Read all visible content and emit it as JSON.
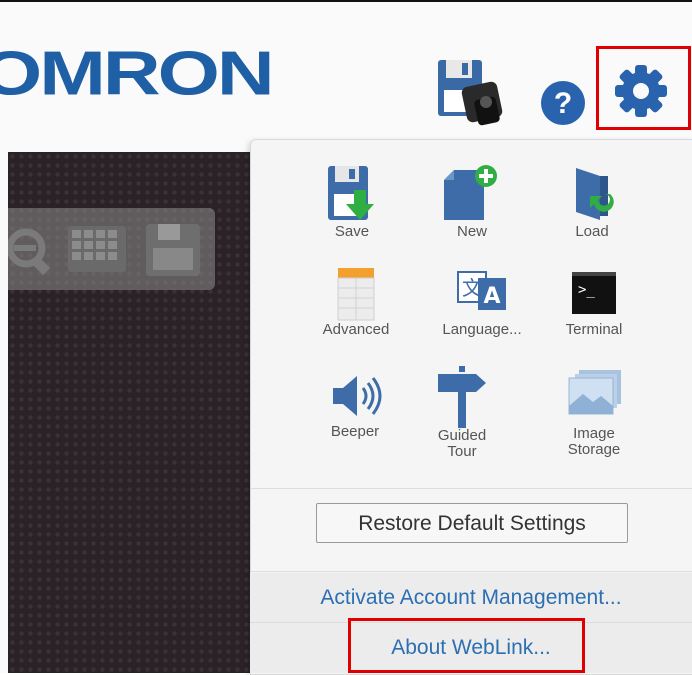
{
  "header": {
    "logo_text": "OMRON"
  },
  "menu": {
    "items": [
      {
        "label": "Save",
        "icon": "save-icon"
      },
      {
        "label": "New",
        "icon": "new-file-icon"
      },
      {
        "label": "Load",
        "icon": "load-icon"
      },
      {
        "label": "Advanced",
        "icon": "advanced-table-icon"
      },
      {
        "label": "Language...",
        "icon": "language-icon"
      },
      {
        "label": "Terminal",
        "icon": "terminal-icon"
      },
      {
        "label": "Beeper",
        "icon": "speaker-icon"
      },
      {
        "label_line1": "Guided",
        "label_line2": "Tour",
        "icon": "signpost-icon"
      },
      {
        "label_line1": "Image",
        "label_line2": "Storage",
        "icon": "image-storage-icon"
      }
    ],
    "restore_label": "Restore Default Settings",
    "activate_label": "Activate Account Management...",
    "about_label": "About WebLink..."
  },
  "colors": {
    "brand": "#1f5fa6",
    "link": "#2c6fb2",
    "highlight": "#e00000",
    "canvas": "#2a2226"
  }
}
